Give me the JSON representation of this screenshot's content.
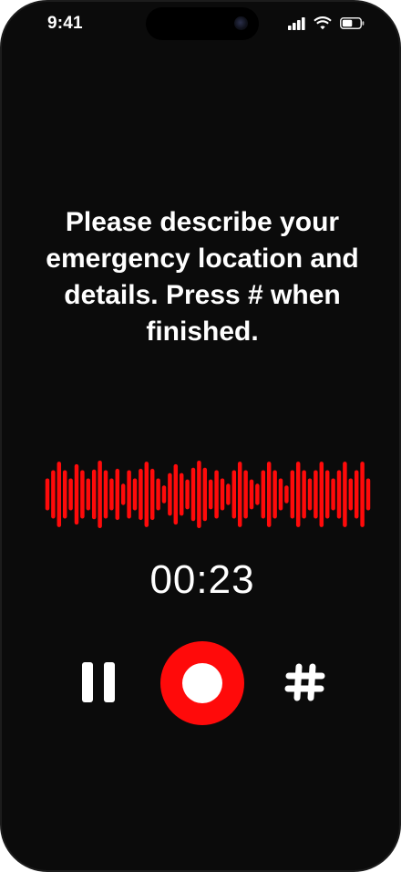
{
  "status_bar": {
    "time": "9:41",
    "icons": [
      "cellular-signal-icon",
      "wifi-icon",
      "battery-icon"
    ]
  },
  "prompt": {
    "text": "Please describe your emergency location and details. Press # when finished."
  },
  "waveform": {
    "color": "#ff0a0a",
    "bar_levels": [
      0.45,
      0.68,
      0.92,
      0.68,
      0.45,
      0.85,
      0.68,
      0.45,
      0.7,
      0.95,
      0.68,
      0.45,
      0.72,
      0.3,
      0.68,
      0.45,
      0.72,
      0.92,
      0.72,
      0.45,
      0.25,
      0.6,
      0.85,
      0.6,
      0.42,
      0.75,
      0.95,
      0.75,
      0.42,
      0.68,
      0.45,
      0.3,
      0.68,
      0.92,
      0.68,
      0.42,
      0.3,
      0.68,
      0.92,
      0.68,
      0.45,
      0.25,
      0.68,
      0.92,
      0.68,
      0.45,
      0.68,
      0.92,
      0.68,
      0.45,
      0.68,
      0.92,
      0.45,
      0.68,
      0.92,
      0.45
    ]
  },
  "timer": {
    "elapsed": "00:23"
  },
  "controls": {
    "pause_icon": "pause-icon",
    "record_icon": "record-icon",
    "finish_icon": "hash-icon",
    "record_color": "#ff0a0a"
  }
}
